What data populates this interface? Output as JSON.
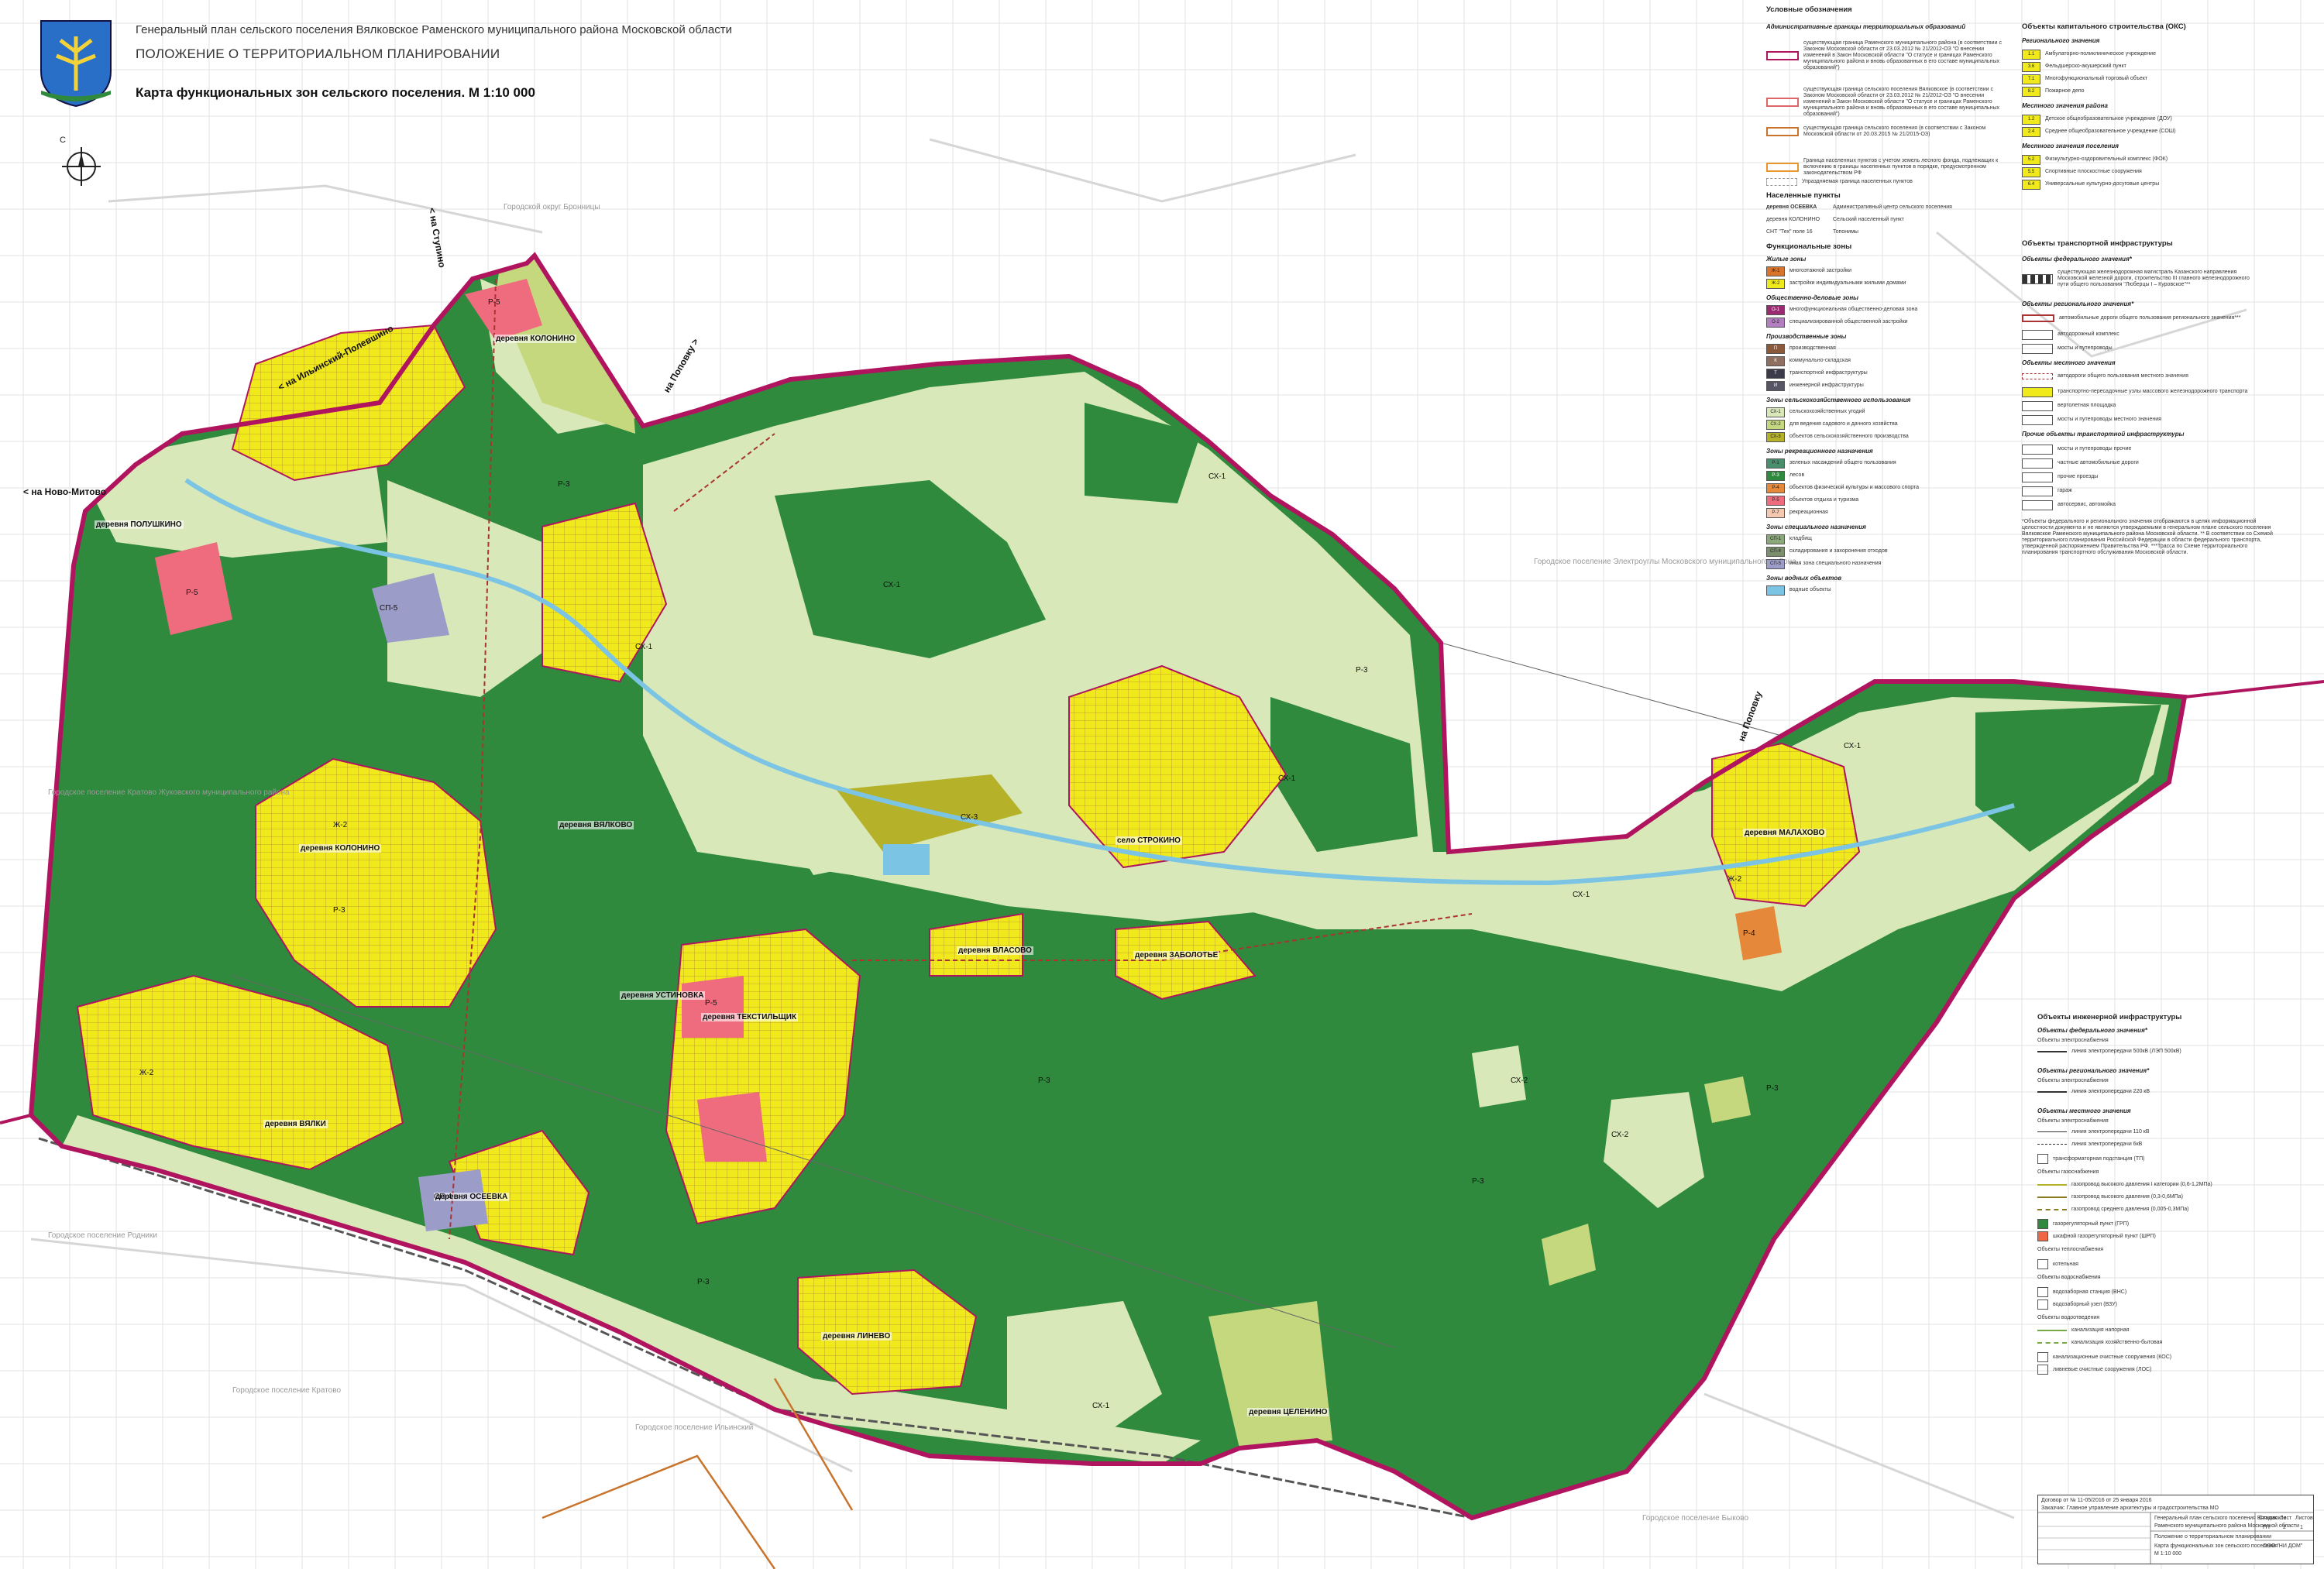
{
  "header": {
    "line1": "Генеральный план сельского поселения Вялковское Раменского муниципального района Московской области",
    "line2": "ПОЛОЖЕНИЕ О ТЕРРИТОРИАЛЬНОМ ПЛАНИРОВАНИИ",
    "line3": "Карта функциональных зон сельского поселения. М 1:10 000"
  },
  "compass": {
    "north": "С"
  },
  "colors": {
    "forest": "#2f8a3e",
    "agri": "#d9e8b8",
    "residential": "#f0e91c",
    "boundary": "#b0145e",
    "recreation": "#ef6c7f",
    "water": "#7cc4e4",
    "special": "#9c9cc9",
    "olive": "#b5b128"
  },
  "neighbors": [
    "Городской округ Бронницы",
    "Городское поселение Электроуглы Московского муниципального района",
    "Городское поселение Кратово Жуковского муниципального района",
    "Городское поселение Родники",
    "Городское поселение Ильинский",
    "Городское поселение Кратово",
    "Городское поселение Быково"
  ],
  "directions": [
    "< на Ново-Митово",
    "< на Ильинский-Полевшино",
    "на Поповку >",
    "на Поповку",
    "< на Ступино"
  ],
  "settlements": [
    "деревня КОЛОНИНО",
    "деревня ПОЛУШКИНО",
    "деревня КОЛОНИНО",
    "деревня ВЯЛКОВО",
    "деревня ТЕКСТИЛЬЩИК",
    "деревня ВЛАСОВО",
    "деревня ЗАБОЛОТЬЕ",
    "деревня ВЯЛКИ",
    "деревня ОСЕЕВКА",
    "деревня УСТИНОВКА",
    "деревня ЦЕЛЕНИНО",
    "деревня ЛИНЕВО",
    "деревня МАЛАХОВО",
    "село СТРОКИНО"
  ],
  "zone_labels": [
    "СХ-1",
    "СХ-2",
    "СХ-3",
    "Р-3",
    "Р-5",
    "Ж-2",
    "Ж-1",
    "СП-5",
    "СП-4",
    "О-1",
    "П-1",
    "Т-1",
    "Р-4"
  ],
  "legend": {
    "title": "Условные обозначения",
    "admin_title": "Административные границы территориальных образований",
    "admin_items": [
      "существующая граница Раменского муниципального района (в соответствии с Законом Московской области от 23.03.2012 № 21/2012-ОЗ \"О внесении изменений в Закон Московской области \"О статусе и границах Раменского муниципального района и вновь образованных в его составе муниципальных образований\")",
      "существующая граница сельского поселения Вялковское (в соответствии с Законом Московской области от 23.03.2012 № 21/2012-ОЗ \"О внесении изменений в Закон Московской области \"О статусе и границах Раменского муниципального района и вновь образованных в его составе муниципальных образований\")",
      "существующая граница сельского поселения (в соответствии с Законом Московской области от 20.03.2015 № 21/2015-ОЗ)",
      "Граница населенных пунктов с учетом земель лесного фонда, подлежащих к включению в границы населенных пунктов в порядке, предусмотренном законодательством РФ",
      "Упраздняемая граница населенных пунктов"
    ],
    "settlements_title": "Населенные пункты",
    "settlement_items": [
      {
        "sample": "деревня ОСЕЕВКА",
        "text": "Административный центр сельского поселения"
      },
      {
        "sample": "деревня КОЛОНИНО",
        "text": "Сельский населенный пункт"
      },
      {
        "sample": "СНТ \"Тех\" поле 16",
        "text": "Топонимы"
      }
    ],
    "zones_title": "Функциональные зоны",
    "zone_groups": [
      {
        "name": "Жилые зоны",
        "items": [
          {
            "code": "Ж-1",
            "color": "#d8742c",
            "text": "многоэтажной застройки"
          },
          {
            "code": "Ж-2",
            "color": "#f0e91c",
            "text": "застройки индивидуальными жилыми домами"
          }
        ]
      },
      {
        "name": "Общественно-деловые зоны",
        "items": [
          {
            "code": "О-1",
            "color": "#9a2a72",
            "text": "многофункциональная общественно-деловая зона"
          },
          {
            "code": "О-2",
            "color": "#b37fc0",
            "text": "специализированной общественной застройки"
          }
        ]
      },
      {
        "name": "Производственные зоны",
        "items": [
          {
            "code": "П",
            "color": "#8b5a3c",
            "text": "производственная"
          },
          {
            "code": "К",
            "color": "#8f6f5f",
            "text": "коммунально-складская"
          },
          {
            "code": "Т",
            "color": "#3a3a4a",
            "text": "транспортной инфраструктуры"
          },
          {
            "code": "И",
            "color": "#555566",
            "text": "инженерной инфраструктуры"
          }
        ]
      },
      {
        "name": "Зоны сельскохозяйственного использования",
        "items": [
          {
            "code": "СХ-1",
            "color": "#d9e8b8",
            "text": "сельскохозяйственных угодий"
          },
          {
            "code": "СХ-2",
            "color": "#c6d87e",
            "text": "для ведения садового и дачного хозяйства"
          },
          {
            "code": "СХ-3",
            "color": "#b5b128",
            "text": "объектов сельскохозяйственного производства"
          }
        ]
      },
      {
        "name": "Зоны рекреационного назначения",
        "items": [
          {
            "code": "Р-1",
            "color": "#4a8f6b",
            "text": "зеленых насаждений общего пользования"
          },
          {
            "code": "Р-3",
            "color": "#2f8a3e",
            "text": "лесов"
          },
          {
            "code": "Р-4",
            "color": "#e5883a",
            "text": "объектов физической культуры и массового спорта"
          },
          {
            "code": "Р-5",
            "color": "#ef6c7f",
            "text": "объектов отдыха и туризма"
          },
          {
            "code": "Р-7",
            "color": "#f5c9b0",
            "text": "рекреационная"
          }
        ]
      },
      {
        "name": "Зоны специального назначения",
        "items": [
          {
            "code": "СП-1",
            "color": "#8aa879",
            "text": "кладбищ"
          },
          {
            "code": "СП-4",
            "color": "#7c8f6d",
            "text": "складирования и захоронения отходов"
          },
          {
            "code": "СП-5",
            "color": "#9c9cc9",
            "text": "иная зона специального назначения"
          }
        ]
      },
      {
        "name": "Зоны водных объектов",
        "items": [
          {
            "code": "",
            "color": "#7cc4e4",
            "text": "водные объекты"
          }
        ]
      }
    ],
    "oks_title": "Объекты капитального строительства (ОКС)",
    "oks_regional_title": "Регионального значения",
    "oks_regional": [
      {
        "code": "1.1",
        "text": "Амбулаторно-поликлиническое учреждение"
      },
      {
        "code": "3.6",
        "text": "Фельдшерско-акушерский пункт"
      },
      {
        "code": "7.1",
        "text": "Многофункциональный торговый объект"
      },
      {
        "code": "8.2",
        "text": "Пожарное депо"
      }
    ],
    "oks_district_title": "Местного значения района",
    "oks_district": [
      {
        "code": "1.2",
        "text": "Детское общеобразовательное учреждение (ДОУ)"
      },
      {
        "code": "2.4",
        "text": "Среднее общеобразовательное учреждение (СОШ)"
      }
    ],
    "oks_local_title": "Местного значения поселения",
    "oks_local": [
      {
        "code": "5.2",
        "text": "Физкультурно-оздоровительный комплекс (ФОК)"
      },
      {
        "code": "5.5",
        "text": "Спортивные плоскостные сооружения"
      },
      {
        "code": "6.4",
        "text": "Универсальные культурно-досуговые центры"
      }
    ],
    "transport_title": "Объекты транспортной инфраструктуры",
    "transport_federal_title": "Объекты федерального значения*",
    "transport_federal": [
      "существующая железнодорожная магистраль Казанского направления Московской железной дороги, строительство III главного железнодорожного пути общего пользования \"Люберцы I – Куровское\"**"
    ],
    "transport_regional_title": "Объекты регионального значения*",
    "transport_regional": [
      "автомобильные дороги общего пользования регионального значения***",
      "автодорожный комплекс",
      "мосты и путепроводы"
    ],
    "transport_local_title": "Объекты местного значения",
    "transport_local": [
      "автодороги общего пользования местного значения",
      "транспортно-пересадочные узлы массового железнодорожного транспорта",
      "вертолетная площадка",
      "мосты и путепроводы местного значения"
    ],
    "transport_other_title": "Прочие объекты транспортной инфраструктуры",
    "transport_other": [
      "мосты и путепроводы прочие",
      "частные автомобильные дороги",
      "прочие проезды",
      "гараж",
      "автосервис, автомойка"
    ],
    "notes": "*Объекты федерального и регионального значения отображаются в целях информационной целостности документа и не являются утверждаемыми в генеральном плане сельского поселения Вялковское Раменского муниципального района Московской области. ** В соответствии со Схемой территориального планирования Российской Федерации в области федерального транспорта, утвержденной распоряжением Правительства РФ. ***Трасса по Схеме территориального планирования транспортного обслуживания Московской области."
  },
  "infra": {
    "title": "Объекты инженерной инфраструктуры",
    "federal_title": "Объекты федерального значения*",
    "federal_sub": "Объекты электроснабжения",
    "federal_items": [
      "линия электропередачи 500кВ (ЛЭП 500кВ)"
    ],
    "regional_title": "Объекты регионального значения*",
    "regional_sub": "Объекты электроснабжения",
    "regional_items": [
      "линия электропередачи 220 кВ"
    ],
    "local_title": "Объекты местного значения",
    "local_electro_sub": "Объекты электроснабжения",
    "local_electro": [
      "линия электропередачи 110 кВ",
      "линия электропередачи 6кВ",
      "трансформаторная подстанция (ТП)"
    ],
    "gas_sub": "Объекты газоснабжения",
    "gas": [
      "газопровод высокого давления I категории (0,6-1,2МПа)",
      "газопровод высокого давления (0,3-0,6МПа)",
      "газопровод среднего давления (0,005-0,3МПа)",
      "газорегуляторный пункт (ГРП)",
      "шкафной газорегуляторный пункт (ШРП)"
    ],
    "heat_sub": "Объекты теплоснабжения",
    "heat": [
      "котельная"
    ],
    "water_sub": "Объекты водоснабжения",
    "water": [
      "водозаборная станция (ВНС)",
      "водозаборный узел (ВЗУ)"
    ],
    "sewer_sub": "Объекты водоотведения",
    "sewer": [
      "канализация напорная",
      "канализация хозяйственно-бытовая",
      "канализационные очистные сооружения (КОС)",
      "ливневые очистные сооружения (ЛОС)"
    ]
  },
  "titleblock": {
    "lines": [
      "Договор от № 11-05/2016 от 25 января 2016",
      "Заказчик: Главное управление архитектуры и градостроительства МО",
      "Генеральный план сельского поселения Вялковское",
      "Раменского муниципального района Московской области",
      "Положение о территориальном планировании",
      "Карта функциональных зон сельского поселения",
      "М 1:10 000",
      "ООО \"НИ ДОМ\""
    ],
    "stage_label": "Стадия",
    "sheet_label": "Лист",
    "sheets_label": "Листов",
    "stage": "ГП",
    "sheet": "2",
    "sheets": "1"
  }
}
